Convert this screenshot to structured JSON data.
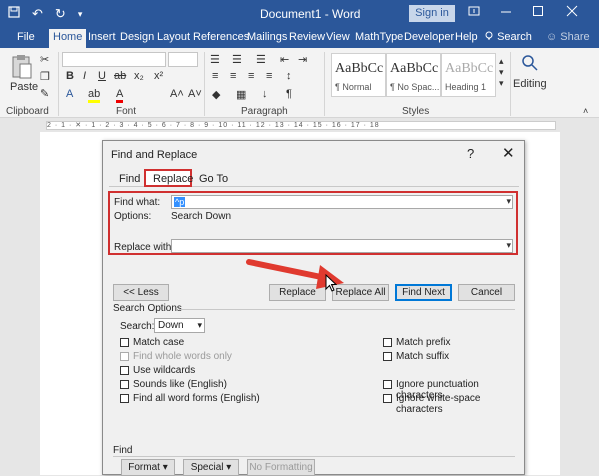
{
  "titlebar": {
    "document_title": "Document1 - Word",
    "sign_in": "Sign in",
    "undo_glyph": "↶",
    "redo_glyph": "↻"
  },
  "tabs": [
    "File",
    "Home",
    "Insert",
    "Design",
    "Layout",
    "References",
    "Mailings",
    "Review",
    "View",
    "MathType",
    "Developer",
    "Help"
  ],
  "tell_me": "Search",
  "share": "Share",
  "ribbon": {
    "groups": {
      "clipboard": "Clipboard",
      "font": "Font",
      "paragraph": "Paragraph",
      "styles": "Styles"
    },
    "paste": "Paste",
    "editing": "Editing",
    "styles": [
      {
        "sample": "AaBbCc",
        "name": "¶ Normal"
      },
      {
        "sample": "AaBbCc",
        "name": "¶ No Spac..."
      },
      {
        "sample": "AaBbCc",
        "name": "Heading 1"
      }
    ]
  },
  "ruler_text": "2 · 1 · ✕ · 1 · 2 · 3 · 4 · 5 · 6 · 7 · 8 · 9 · 10 · 11 · 12 · 13 · 14 · 15 · 16 · 17 · 18",
  "dialog": {
    "title": "Find and Replace",
    "help": "?",
    "close": "✕",
    "tabs": {
      "find": "Find",
      "replace": "Replace",
      "goto": "Go To"
    },
    "find_what_label": "Find what:",
    "find_what_value": "^p",
    "options_label": "Options:",
    "options_value": "Search Down",
    "replace_with_label": "Replace with:",
    "replace_with_value": "",
    "buttons": {
      "less": "<< Less",
      "replace": "Replace",
      "replace_all": "Replace All",
      "find_next": "Find Next",
      "cancel": "Cancel"
    },
    "search_options_header": "Search Options",
    "search_label": "Search:",
    "search_value": "Down",
    "left_options": [
      {
        "label": "Match case",
        "enabled": true
      },
      {
        "label": "Find whole words only",
        "enabled": false
      },
      {
        "label": "Use wildcards",
        "enabled": true
      },
      {
        "label": "Sounds like (English)",
        "enabled": true
      },
      {
        "label": "Find all word forms (English)",
        "enabled": true
      }
    ],
    "right_options": [
      {
        "label": "Match prefix",
        "enabled": true
      },
      {
        "label": "Match suffix",
        "enabled": true
      },
      {
        "label": "Ignore punctuation characters",
        "enabled": true
      },
      {
        "label": "Ignore white-space characters",
        "enabled": true
      }
    ],
    "find_section_header": "Find",
    "bottom_buttons": {
      "format": "Format ▾",
      "special": "Special ▾",
      "no_formatting": "No Formatting"
    }
  },
  "colors": {
    "title_bar": "#2b579a",
    "highlight_frame": "#d03030",
    "annotation_arrow": "#e03a2f"
  }
}
